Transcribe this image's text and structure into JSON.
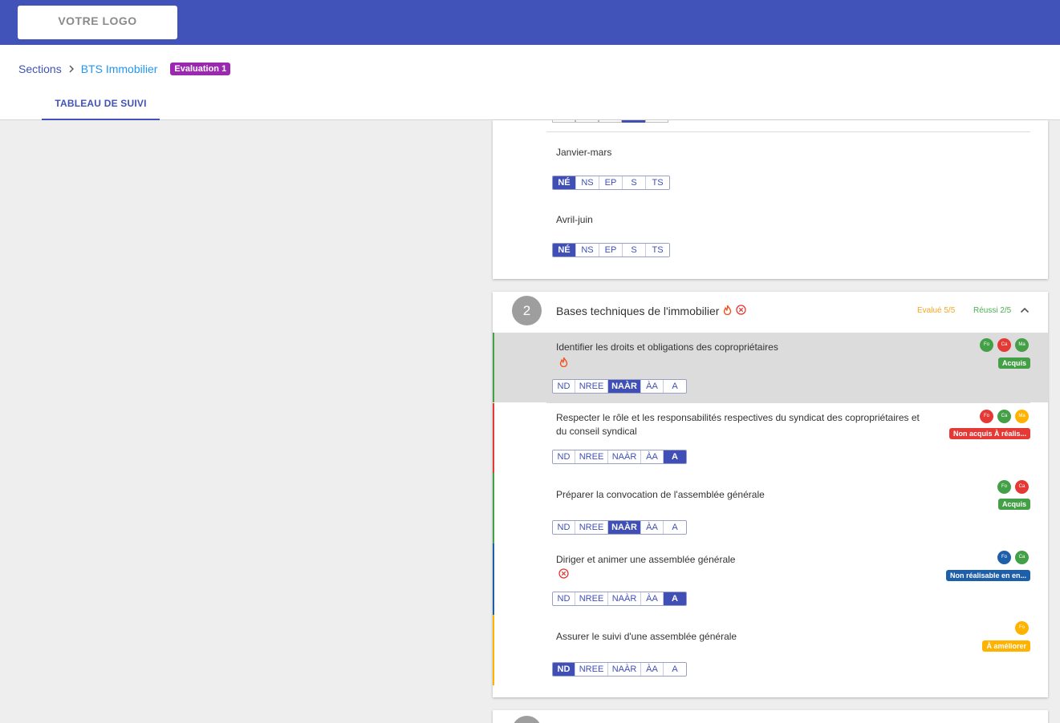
{
  "header": {
    "logo": "VOTRE LOGO"
  },
  "breadcrumb": {
    "sections": "Sections",
    "course": "BTS Immobilier",
    "badge": "Evaluation 1"
  },
  "tabs": [
    {
      "label": "TABLEAU DE SUIVI"
    }
  ],
  "period_scale": [
    "NÉ",
    "NS",
    "EP",
    "S",
    "TS"
  ],
  "periods": [
    {
      "label": "Janvier-mars",
      "selected": "NÉ"
    },
    {
      "label": "Avril-juin",
      "selected": "NÉ"
    }
  ],
  "section2": {
    "number": "2",
    "title": "Bases techniques de l'immobilier",
    "evalue": "Evalué 5/5",
    "reussi": "Réussi 2/5"
  },
  "criteria_scale": [
    "ND",
    "NREE",
    "NAÀR",
    "ÀA",
    "A"
  ],
  "criteria": [
    {
      "text": "Identifier les droits et obligations des copropriétaires",
      "status": "Acquis",
      "status_color": "#43a047",
      "selected": "NAÀR",
      "avatars": [
        "Fo",
        "Ca",
        "Ma"
      ]
    },
    {
      "text": "Respecter le rôle et les responsabilités respectives du syndicat des copropriétaires et du conseil syndical",
      "status": "Non acquis À réalis...",
      "status_color": "#e53935",
      "selected": "A",
      "avatars": [
        "Fo",
        "Ca",
        "Ma"
      ]
    },
    {
      "text": "Préparer la convocation de l'assemblée générale",
      "status": "Acquis",
      "status_color": "#43a047",
      "selected": "NAÀR",
      "avatars": [
        "Fo",
        "Ca"
      ]
    },
    {
      "text": "Diriger et animer une assemblée générale",
      "status": "Non réalisable en en...",
      "status_color": "#1e5faa",
      "selected": "A",
      "avatars": [
        "Fo",
        "Ca"
      ]
    },
    {
      "text": "Assurer le suivi d'une assemblée générale",
      "status": "À améliorer",
      "status_color": "#ffb300",
      "selected": "ND",
      "avatars": [
        "Fo"
      ]
    }
  ],
  "colors": {
    "primary": "#4152b8",
    "link": "#2196f3",
    "badge": "#9c27b0",
    "green": "#43a047",
    "red": "#e53935",
    "blue": "#1e5faa",
    "orange": "#ffb300"
  }
}
